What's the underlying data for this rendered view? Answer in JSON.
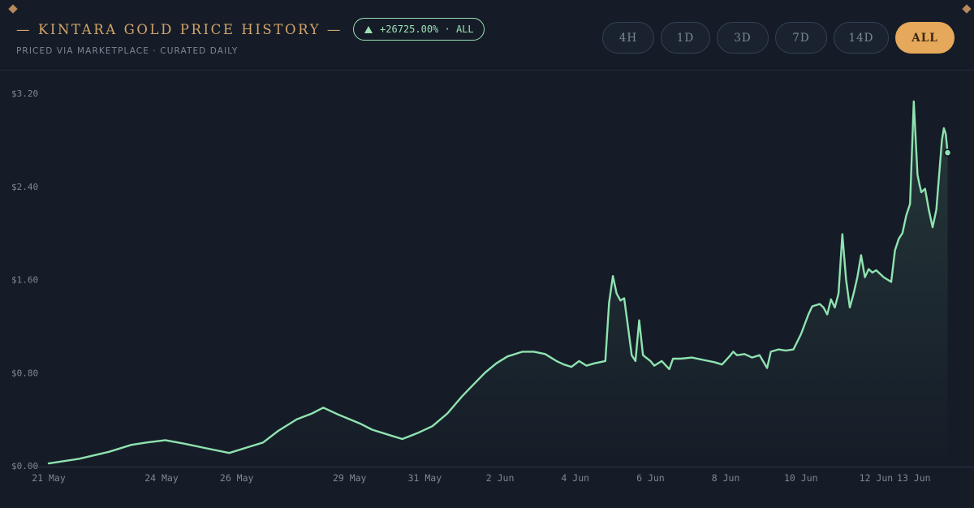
{
  "header": {
    "title": "— KINTARA GOLD PRICE HISTORY —",
    "change_badge": "+26725.00% · ALL",
    "subtitle": "PRICED VIA MARKETPLACE · CURATED DAILY"
  },
  "ranges": [
    {
      "label": "4H",
      "active": false
    },
    {
      "label": "1D",
      "active": false
    },
    {
      "label": "3D",
      "active": false
    },
    {
      "label": "7D",
      "active": false
    },
    {
      "label": "14D",
      "active": false
    },
    {
      "label": "ALL",
      "active": true
    }
  ],
  "colors": {
    "background": "#151c27",
    "gold_title": "#d4a46a",
    "line": "#8fe3b0",
    "badge": "#9ae0b5",
    "muted": "#7d8794",
    "active_button": "#e6a85a",
    "corner_ornament": "#b8895a"
  },
  "chart_data": {
    "type": "area",
    "title": "KINTARA GOLD PRICE HISTORY",
    "xlabel": "",
    "ylabel": "",
    "ylim": [
      0,
      3.2
    ],
    "y_ticks": [
      "$0.00",
      "$0.80",
      "$1.60",
      "$2.40",
      "$3.20"
    ],
    "y_tick_values": [
      0,
      0.8,
      1.6,
      2.4,
      3.2
    ],
    "x_ticks": [
      "21 May",
      "24 May",
      "26 May",
      "29 May",
      "31 May",
      "2 Jun",
      "4 Jun",
      "6 Jun",
      "8 Jun",
      "10 Jun",
      "12 Jun",
      "13 Jun"
    ],
    "x_tick_days": [
      0,
      3,
      5,
      8,
      10,
      12,
      14,
      16,
      18,
      20,
      22,
      23
    ],
    "grid": false,
    "series": [
      {
        "x_days": [
          0,
          0.8,
          1.6,
          2.2,
          2.6,
          3.1,
          3.6,
          4.2,
          4.8,
          5.3,
          5.7,
          6.1,
          6.6,
          7.0,
          7.3,
          7.7,
          8.0,
          8.3,
          8.6,
          9.0,
          9.4,
          9.8,
          10.2,
          10.6,
          11.0,
          11.3,
          11.6,
          11.9,
          12.2,
          12.6,
          12.9,
          13.2,
          13.5,
          13.7,
          13.9,
          14.1,
          14.3,
          14.5,
          14.8,
          14.9,
          15.0,
          15.1,
          15.2,
          15.3,
          15.4,
          15.5,
          15.6,
          15.7,
          15.8,
          16.0,
          16.1,
          16.3,
          16.5,
          16.6,
          16.8,
          17.1,
          17.4,
          17.7,
          17.9,
          18.1,
          18.2,
          18.3,
          18.5,
          18.7,
          18.9,
          19.1,
          19.2,
          19.4,
          19.6,
          19.8,
          20.0,
          20.2,
          20.3,
          20.5,
          20.6,
          20.7,
          20.8,
          20.9,
          21.0,
          21.1,
          21.2,
          21.3,
          21.4,
          21.5,
          21.6,
          21.7,
          21.8,
          21.9,
          22.0,
          22.2,
          22.4,
          22.5,
          22.6,
          22.7,
          22.8,
          22.9,
          23.0,
          23.1,
          23.15,
          23.2,
          23.3,
          23.4,
          23.5,
          23.6,
          23.7,
          23.75,
          23.8,
          23.85,
          23.9
        ],
        "values": [
          0.02,
          0.06,
          0.12,
          0.18,
          0.2,
          0.22,
          0.19,
          0.15,
          0.11,
          0.16,
          0.2,
          0.3,
          0.4,
          0.45,
          0.5,
          0.44,
          0.4,
          0.36,
          0.31,
          0.27,
          0.23,
          0.28,
          0.34,
          0.45,
          0.6,
          0.7,
          0.8,
          0.88,
          0.94,
          0.98,
          0.98,
          0.96,
          0.9,
          0.87,
          0.85,
          0.9,
          0.86,
          0.88,
          0.9,
          1.4,
          1.63,
          1.48,
          1.42,
          1.44,
          1.2,
          0.95,
          0.9,
          1.25,
          0.95,
          0.9,
          0.86,
          0.9,
          0.83,
          0.92,
          0.92,
          0.93,
          0.91,
          0.89,
          0.87,
          0.94,
          0.98,
          0.95,
          0.96,
          0.93,
          0.95,
          0.84,
          0.98,
          1.0,
          0.99,
          1.0,
          1.13,
          1.3,
          1.37,
          1.39,
          1.36,
          1.3,
          1.43,
          1.36,
          1.48,
          1.99,
          1.6,
          1.36,
          1.48,
          1.62,
          1.81,
          1.62,
          1.69,
          1.66,
          1.68,
          1.62,
          1.58,
          1.85,
          1.95,
          2.0,
          2.15,
          2.25,
          3.13,
          2.5,
          2.42,
          2.35,
          2.38,
          2.2,
          2.05,
          2.2,
          2.6,
          2.8,
          2.9,
          2.85,
          2.69
        ]
      }
    ]
  }
}
